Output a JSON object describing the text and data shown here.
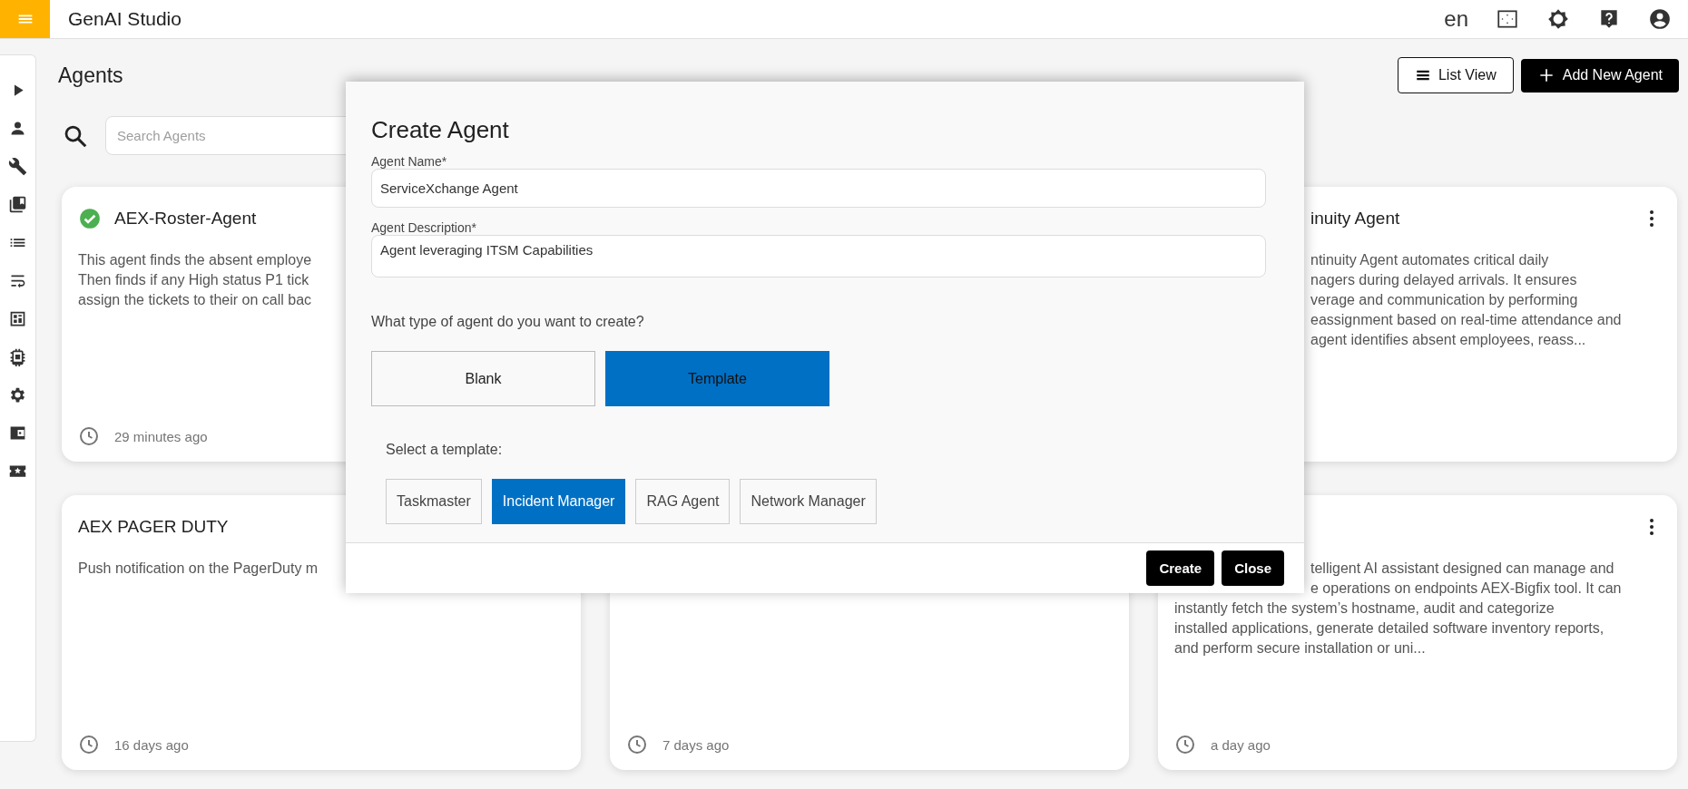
{
  "top_bar": {
    "title": "GenAI Studio",
    "language": "en"
  },
  "page": {
    "title": "Agents",
    "list_view_button": "List View",
    "add_button": "Add New Agent",
    "search": {
      "placeholder": "Search Agents"
    }
  },
  "cards": [
    {
      "verified": true,
      "title": "AEX-Roster-Agent",
      "description_lines": [
        "This agent finds the absent employe",
        "Then finds if any High status P1 tick",
        "assign the tickets to their on call bac"
      ],
      "time": "29 minutes ago"
    },
    {
      "title": "inuity Agent",
      "description_lines": [
        "ntinuity Agent automates critical daily",
        "nagers during delayed arrivals. It ensures",
        "verage and communication by performing",
        "eassignment based on real-time attendance and",
        "agent identifies absent employees, reass..."
      ]
    },
    {
      "title": "AEX PAGER DUTY",
      "description_lines": [
        "Push notification on the PagerDuty m"
      ],
      "time": "16 days ago"
    },
    {
      "time": "7 days ago"
    },
    {
      "description_lines": [
        "telligent AI assistant designed can manage and",
        "e operations on endpoints AEX-Bigfix tool. It can",
        "instantly fetch the system’s hostname, audit and categorize",
        "installed applications, generate detailed software inventory reports,",
        "and perform secure installation or uni..."
      ],
      "time": "a day ago"
    }
  ],
  "dialog": {
    "title": "Create Agent",
    "fields": [
      {
        "label": "Agent Name*",
        "value": "ServiceXchange Agent"
      },
      {
        "label": "Agent Description*",
        "value": "Agent leveraging ITSM Capabilities"
      }
    ],
    "question": "What type of agent do you want to create?",
    "agent_types": [
      {
        "label": "Blank",
        "selected": false
      },
      {
        "label": "Template",
        "selected": true
      }
    ],
    "template_prompt": "Select a template:",
    "templates": [
      {
        "label": "Taskmaster",
        "selected": false
      },
      {
        "label": "Incident Manager",
        "selected": true
      },
      {
        "label": "RAG Agent",
        "selected": false
      },
      {
        "label": "Network Manager",
        "selected": false
      }
    ],
    "buttons": [
      "Create",
      "Close"
    ]
  }
}
